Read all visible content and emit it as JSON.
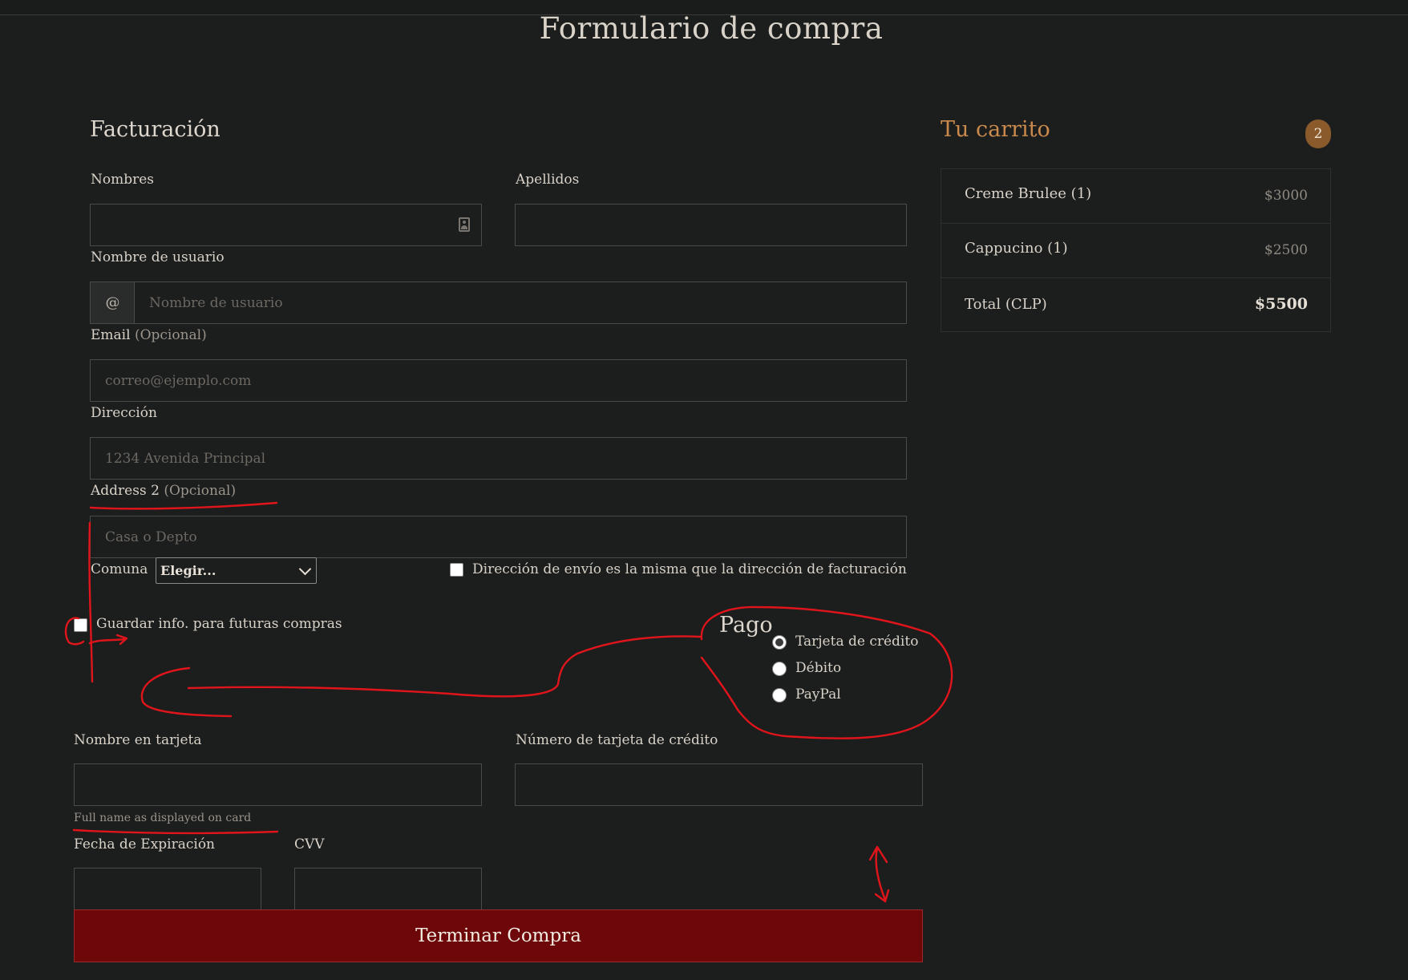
{
  "page": {
    "title": "Formulario de compra"
  },
  "billing": {
    "title": "Facturación",
    "first_name": {
      "label": "Nombres",
      "value": ""
    },
    "last_name": {
      "label": "Apellidos",
      "value": ""
    },
    "username": {
      "label": "Nombre de usuario",
      "addon": "@",
      "placeholder": "Nombre de usuario",
      "value": ""
    },
    "email": {
      "label": "Email",
      "optional": "(Opcional)",
      "placeholder": "correo@ejemplo.com",
      "value": ""
    },
    "address": {
      "label": "Dirección",
      "placeholder": "1234 Avenida Principal",
      "value": ""
    },
    "address2": {
      "label": "Address 2",
      "optional": "(Opcional)",
      "placeholder": "Casa o Depto",
      "value": ""
    },
    "comuna": {
      "label": "Comuna",
      "selected": "Elegir..."
    },
    "same_address": {
      "label": "Dirección de envío es la misma que la dirección de facturación",
      "checked": false
    },
    "save_info": {
      "label": "Guardar info. para futuras compras",
      "checked": false
    }
  },
  "payment": {
    "title": "Pago",
    "options": [
      {
        "label": "Tarjeta de crédito",
        "checked": true
      },
      {
        "label": "Débito",
        "checked": false
      },
      {
        "label": "PayPal",
        "checked": false
      }
    ],
    "card_name": {
      "label": "Nombre en tarjeta",
      "help": "Full name as displayed on card",
      "value": ""
    },
    "card_number": {
      "label": "Número de tarjeta de crédito",
      "value": ""
    },
    "expiration": {
      "label": "Fecha de Expiración",
      "value": ""
    },
    "cvv": {
      "label": "CVV",
      "value": ""
    },
    "submit_label": "Terminar Compra"
  },
  "cart": {
    "title": "Tu carrito",
    "count": "2",
    "items": [
      {
        "name": "Creme Brulee (1)",
        "price": "$3000"
      },
      {
        "name": "Cappucino (1)",
        "price": "$2500"
      }
    ],
    "total_label": "Total (CLP)",
    "total_value": "$5500"
  },
  "colors": {
    "background": "#1c1d1d",
    "accent": "#c98a4c",
    "badge": "#8a5a2b",
    "submit": "#6e0709",
    "annotation": "#e0151b"
  },
  "icons": {
    "first_name_field": "contact-card-icon",
    "comuna_select": "chevron-down-icon"
  }
}
